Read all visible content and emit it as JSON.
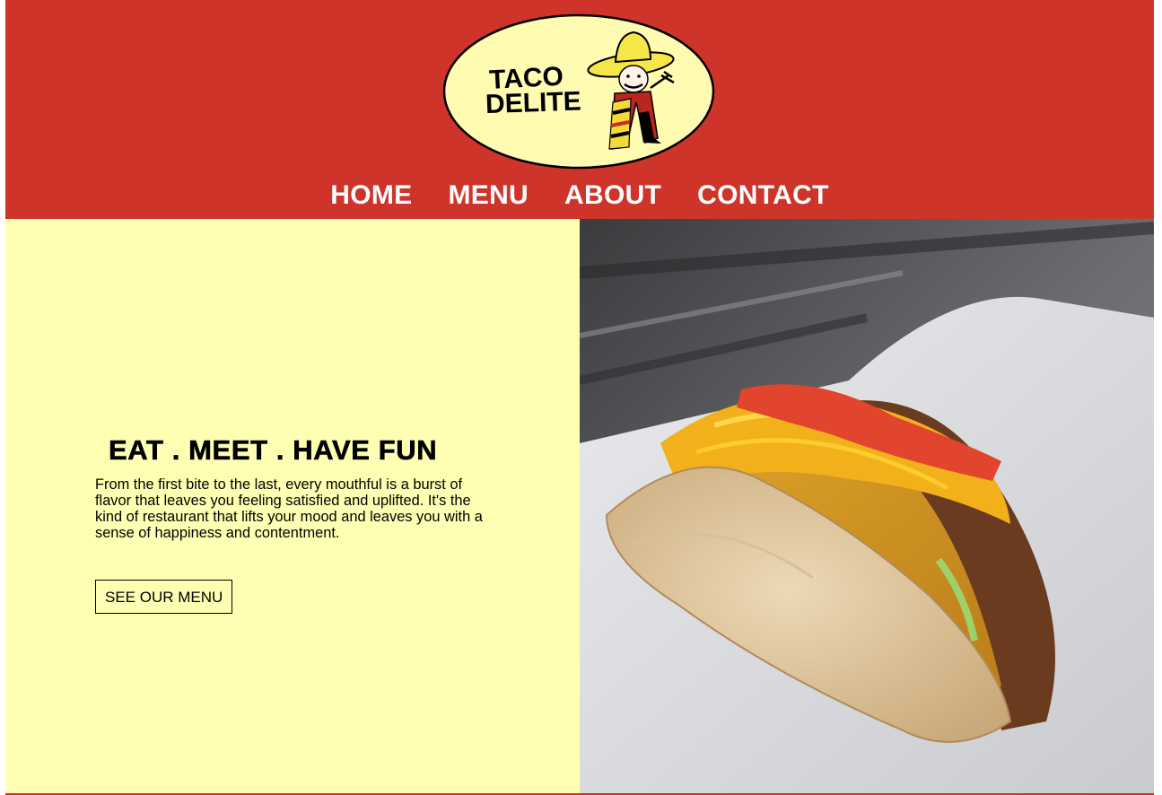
{
  "brand": {
    "logo_line1": "TACO",
    "logo_line2": "DELITE",
    "colors": {
      "header_red": "#cf342a",
      "cream": "#ffffb3",
      "logo_cream": "#fffbb0"
    }
  },
  "nav": {
    "items": [
      {
        "label": "HOME"
      },
      {
        "label": "MENU"
      },
      {
        "label": "ABOUT"
      },
      {
        "label": "CONTACT"
      }
    ]
  },
  "hero": {
    "title": "EAT . MEET . HAVE FUN",
    "copy": "From the first bite to the last, every mouthful is a burst of flavor that leaves you feeling satisfied and uplifted. It's the kind of restaurant that lifts your mood and leaves you with a sense of happiness and contentment.",
    "button_label": "SEE OUR MENU"
  },
  "icons": {
    "logo": "taco-delite-mascot-logo",
    "photo": "taco-photo"
  }
}
